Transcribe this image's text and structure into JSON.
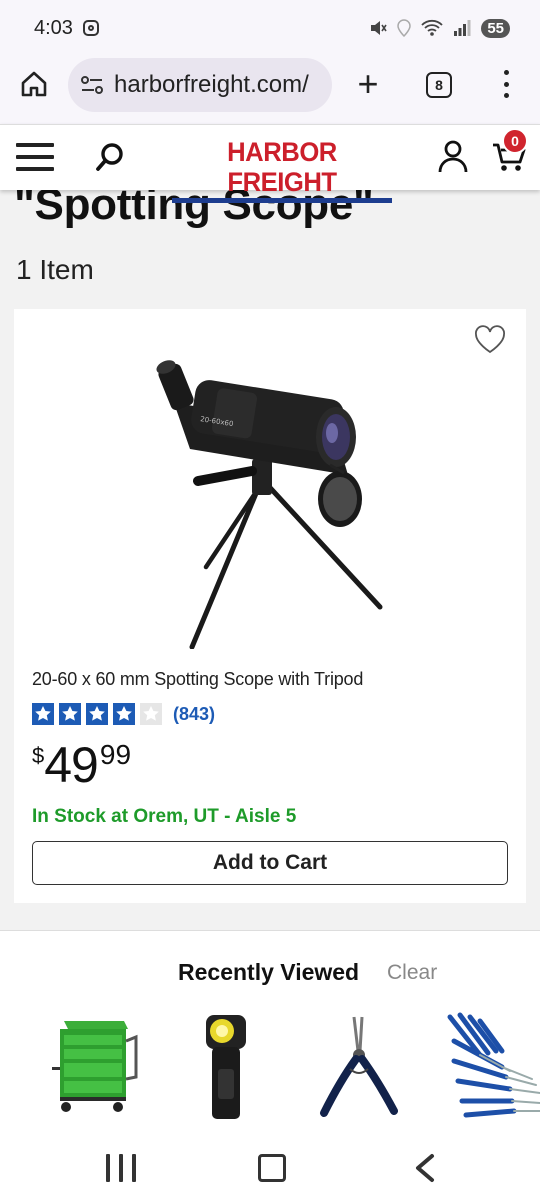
{
  "status_bar": {
    "time": "4:03",
    "battery": "55"
  },
  "browser": {
    "url": "harborfreight.com/",
    "tab_count": "8"
  },
  "site_header": {
    "logo_text": "HARBOR FREIGHT",
    "cart_count": "0",
    "brand_red": "#cc1f2b",
    "brand_blue": "#1d3d8f"
  },
  "results": {
    "heading": "\"Spotting Scope\"",
    "count": "1 Item"
  },
  "product": {
    "name": "20-60 x 60 mm Spotting Scope with Tripod",
    "rating": 4,
    "rating_max": 5,
    "review_count": "(843)",
    "price_sign": "$",
    "price_dollars": "49",
    "price_cents": "99",
    "stock": "In Stock at Orem, UT - Aisle 5",
    "add_to_cart_label": "Add to Cart",
    "stock_color": "#1e9b2a",
    "star_color": "#1d5bb5"
  },
  "recently_viewed": {
    "title": "Recently Viewed",
    "clear_label": "Clear",
    "items": [
      "green-tool-cart",
      "flashlight",
      "snap-ring-pliers",
      "screwdriver-set"
    ]
  }
}
